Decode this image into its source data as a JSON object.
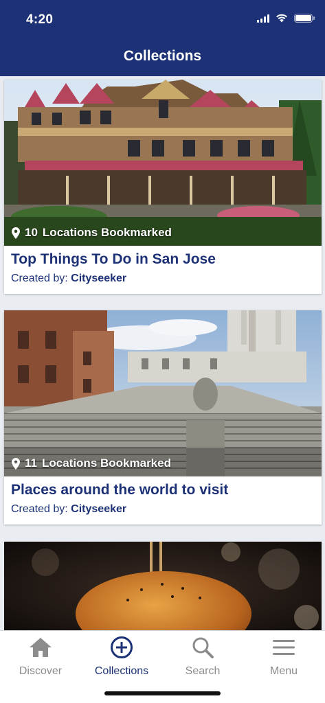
{
  "status_bar": {
    "time": "4:20"
  },
  "header": {
    "title": "Collections"
  },
  "collections": [
    {
      "bookmark_count": "10",
      "bookmark_label": "Locations Bookmarked",
      "title": "Top Things To Do in San Jose",
      "created_by_label": "Created by:",
      "creator": "Cityseeker"
    },
    {
      "bookmark_count": "11",
      "bookmark_label": "Locations Bookmarked",
      "title": "Places around the world to visit",
      "created_by_label": "Created by:",
      "creator": "Cityseeker"
    }
  ],
  "tabs": [
    {
      "label": "Discover",
      "icon": "home-icon"
    },
    {
      "label": "Collections",
      "icon": "add-circle-icon"
    },
    {
      "label": "Search",
      "icon": "search-icon"
    },
    {
      "label": "Menu",
      "icon": "menu-icon"
    }
  ],
  "colors": {
    "brand": "#1d3276",
    "inactive_tab": "#8c8c8c",
    "background": "#e9edf1"
  }
}
